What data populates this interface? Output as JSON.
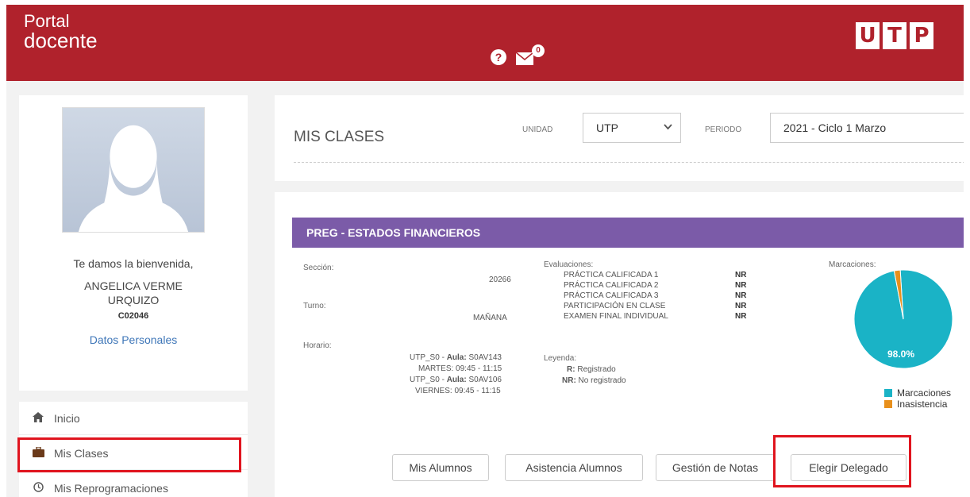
{
  "header": {
    "brand_line1": "Portal",
    "brand_line2": "docente",
    "help_icon": "?",
    "mail_badge": "0",
    "logo_letters": [
      "U",
      "T",
      "P"
    ]
  },
  "profile": {
    "welcome": "Te damos la bienvenida,",
    "name_line1": "ANGELICA VERME",
    "name_line2": "URQUIZO",
    "code": "C02046",
    "link": "Datos Personales"
  },
  "nav": {
    "items": [
      {
        "label": "Inicio",
        "icon": "home-icon"
      },
      {
        "label": "Mis Clases",
        "icon": "briefcase-icon"
      },
      {
        "label": "Mis Reprogramaciones",
        "icon": "clock-icon"
      }
    ]
  },
  "mis_clases": {
    "title": "MIS CLASES",
    "unidad_label": "UNIDAD",
    "unidad_value": "UTP",
    "periodo_label": "PERIODO",
    "periodo_value": "2021 - Ciclo 1 Marzo"
  },
  "class": {
    "title": "PREG - ESTADOS FINANCIEROS",
    "seccion_label": "Sección:",
    "seccion_value": "20266",
    "turno_label": "Turno:",
    "turno_value": "MAÑANA",
    "horario_label": "Horario:",
    "horario": [
      {
        "prefix": "UTP_S0  - ",
        "bold": "Aula:",
        "suffix": " S0AV143"
      },
      {
        "prefix": "MARTES: 09:45 - 11:15",
        "bold": "",
        "suffix": ""
      },
      {
        "prefix": "UTP_S0  - ",
        "bold": "Aula:",
        "suffix": " S0AV106"
      },
      {
        "prefix": "VIERNES: 09:45 - 11:15",
        "bold": "",
        "suffix": ""
      }
    ],
    "evaluaciones_label": "Evaluaciones:",
    "evaluaciones": [
      {
        "name": "PRÁCTICA CALIFICADA 1",
        "status": "NR"
      },
      {
        "name": "PRÁCTICA CALIFICADA 2",
        "status": "NR"
      },
      {
        "name": "PRÁCTICA CALIFICADA 3",
        "status": "NR"
      },
      {
        "name": "PARTICIPACIÓN EN CLASE",
        "status": "NR"
      },
      {
        "name": "EXAMEN FINAL INDIVIDUAL",
        "status": "NR"
      }
    ],
    "leyenda_label": "Leyenda:",
    "leyenda": [
      {
        "key": "R:",
        "text": " Registrado"
      },
      {
        "key": "NR:",
        "text": " No registrado"
      }
    ],
    "marcaciones_label": "Marcaciones:",
    "buttons": {
      "alumnos": "Mis Alumnos",
      "asistencia": "Asistencia Alumnos",
      "notas": "Gestión de Notas",
      "delegado": "Elegir Delegado"
    }
  },
  "chart_data": {
    "type": "pie",
    "categories": [
      "Marcaciones",
      "Inasistencia"
    ],
    "values": [
      98.0,
      2.0
    ],
    "colors": [
      "#1ab3c6",
      "#e8901c"
    ],
    "data_labels": [
      "98.0%"
    ],
    "legend_position": "bottom"
  }
}
